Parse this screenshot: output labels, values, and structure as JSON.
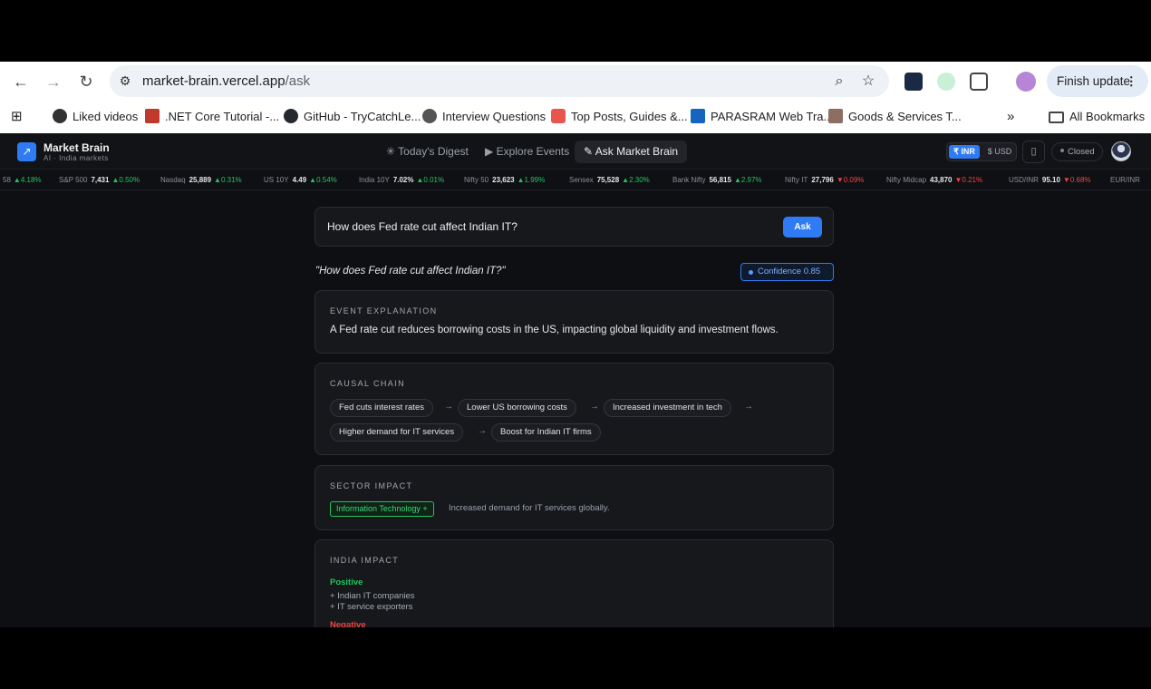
{
  "browser": {
    "url_host": "market-brain.vercel.app",
    "url_path": "/ask",
    "finish_update": "Finish update",
    "bookmarks": [
      {
        "label": "Liked videos"
      },
      {
        "label": ".NET Core Tutorial -..."
      },
      {
        "label": "GitHub - TryCatchLe..."
      },
      {
        "label": "Interview Questions"
      },
      {
        "label": "Top Posts, Guides &..."
      },
      {
        "label": "PARASRAM Web Tra..."
      },
      {
        "label": "Goods & Services T..."
      }
    ],
    "all_bookmarks": "All Bookmarks"
  },
  "app": {
    "brand": "Market Brain",
    "brand_sub": "AI · India markets",
    "nav": [
      {
        "label": "Today's Digest",
        "icon": "sparkle-icon"
      },
      {
        "label": "Explore Events",
        "icon": "play-icon"
      },
      {
        "label": "Ask Market Brain",
        "icon": "wand-icon"
      }
    ],
    "currency_inr": "₹ INR",
    "currency_usd": "$ USD",
    "market_status": "Closed"
  },
  "ticker": [
    {
      "name": "",
      "value": "",
      "change": "4.18%",
      "dir": "up",
      "prefix": "58"
    },
    {
      "name": "S&P 500",
      "value": "7,431",
      "change": "0.50%",
      "dir": "up"
    },
    {
      "name": "Nasdaq",
      "value": "25,889",
      "change": "0.31%",
      "dir": "up"
    },
    {
      "name": "US 10Y",
      "value": "4.49",
      "change": "0.54%",
      "dir": "up"
    },
    {
      "name": "India 10Y",
      "value": "7.02%",
      "change": "0.01%",
      "dir": "up"
    },
    {
      "name": "Nifty 50",
      "value": "23,623",
      "change": "1.99%",
      "dir": "up"
    },
    {
      "name": "Sensex",
      "value": "75,528",
      "change": "2.30%",
      "dir": "up"
    },
    {
      "name": "Bank Nifty",
      "value": "56,815",
      "change": "2.97%",
      "dir": "up"
    },
    {
      "name": "Nifty IT",
      "value": "27,796",
      "change": "0.09%",
      "dir": "down"
    },
    {
      "name": "Nifty Midcap",
      "value": "43,870",
      "change": "0.21%",
      "dir": "down"
    },
    {
      "name": "USD/INR",
      "value": "95.10",
      "change": "0.68%",
      "dir": "down"
    },
    {
      "name": "EUR/INR",
      "value": "",
      "change": "",
      "dir": "up"
    }
  ],
  "ask": {
    "query": "How does Fed rate cut affect Indian IT?",
    "button": "Ask",
    "question_echo": "\"How does Fed rate cut affect Indian IT?\"",
    "confidence": "Confidence 0.85"
  },
  "event_explanation": {
    "title": "EVENT EXPLANATION",
    "text": "A Fed rate cut reduces borrowing costs in the US, impacting global liquidity and investment flows."
  },
  "causal_chain": {
    "title": "CAUSAL CHAIN",
    "steps": [
      "Fed cuts interest rates",
      "Lower US borrowing costs",
      "Increased investment in tech",
      "Higher demand for IT services",
      "Boost for Indian IT firms"
    ],
    "arrow": "→"
  },
  "sector_impact": {
    "title": "SECTOR IMPACT",
    "tag": "Information Technology +",
    "desc": "Increased demand for IT services globally."
  },
  "india_impact": {
    "title": "INDIA IMPACT",
    "positive_label": "Positive",
    "positive": [
      "+ Indian IT companies",
      "+ IT service exporters"
    ],
    "negative_label": "Negative"
  }
}
